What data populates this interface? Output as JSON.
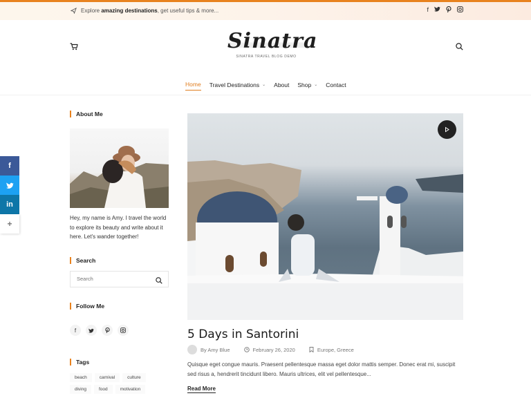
{
  "topbar": {
    "prefix": "Explore",
    "highlight": "amazing destinations",
    "suffix": ", get useful tips & more...",
    "social": [
      "facebook-icon",
      "twitter-icon",
      "pinterest-icon",
      "instagram-icon"
    ]
  },
  "header": {
    "logo_text": "Sinatra",
    "tagline": "SINATRA TRAVEL BLOG DEMO"
  },
  "nav": {
    "items": [
      {
        "label": "Home",
        "active": true,
        "dropdown": false
      },
      {
        "label": "Travel Destinations",
        "active": false,
        "dropdown": true
      },
      {
        "label": "About",
        "active": false,
        "dropdown": false
      },
      {
        "label": "Shop",
        "active": false,
        "dropdown": true
      },
      {
        "label": "Contact",
        "active": false,
        "dropdown": false
      }
    ]
  },
  "share": {
    "more": "+"
  },
  "sidebar": {
    "about_title": "About Me",
    "about_text": "Hey, my name is Amy. I travel the world to explore its beauty and write about it here. Let's wander together!",
    "search_title": "Search",
    "search_placeholder": "Search",
    "follow_title": "Follow Me",
    "tags_title": "Tags",
    "tags": [
      "beach",
      "carnival",
      "culture",
      "diving",
      "food",
      "motivation"
    ]
  },
  "post": {
    "title": "5 Days in Santorini",
    "author": "By Amy Blue",
    "date": "February 26, 2020",
    "categories": "Europe, Greece",
    "excerpt": "Quisque eget congue mauris. Praesent pellentesque massa eget dolor mattis semper. Donec erat mi, suscipit sed risus a, hendrerit tincidunt libero. Mauris ultrices, elit vel pellentesque...",
    "read_more": "Read More"
  },
  "colors": {
    "accent": "#e8821e",
    "facebook": "#3b5998",
    "twitter": "#1da1f2",
    "linkedin": "#0e76a8"
  }
}
